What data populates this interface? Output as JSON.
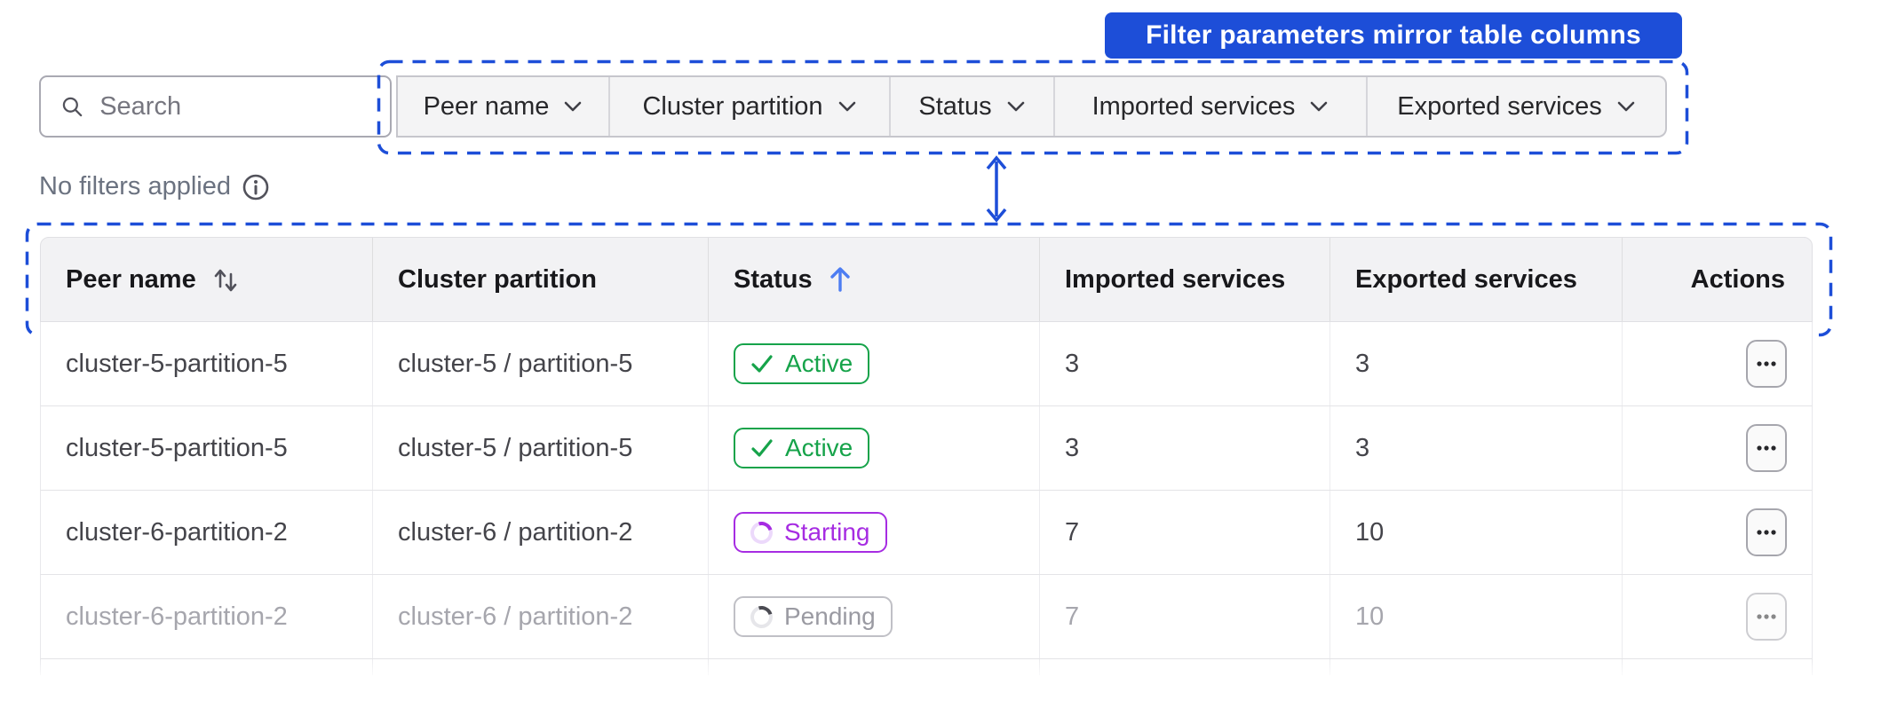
{
  "annotation": {
    "banner_text": "Filter parameters mirror table columns"
  },
  "search": {
    "placeholder": "Search"
  },
  "filters": [
    {
      "label": "Peer name"
    },
    {
      "label": "Cluster partition"
    },
    {
      "label": "Status"
    },
    {
      "label": "Imported services"
    },
    {
      "label": "Exported services"
    }
  ],
  "filter_status_text": "No filters applied",
  "table": {
    "columns": [
      {
        "label": "Peer name",
        "sort": "both"
      },
      {
        "label": "Cluster partition",
        "sort": "none"
      },
      {
        "label": "Status",
        "sort": "asc"
      },
      {
        "label": "Imported services",
        "sort": "none"
      },
      {
        "label": "Exported services",
        "sort": "none"
      },
      {
        "label": "Actions",
        "sort": "none"
      }
    ],
    "rows": [
      {
        "peer_name": "cluster-5-partition-5",
        "cluster_partition": "cluster-5 / partition-5",
        "status": "Active",
        "status_kind": "active",
        "imported": "3",
        "exported": "3",
        "dimmed": false
      },
      {
        "peer_name": "cluster-5-partition-5",
        "cluster_partition": "cluster-5 / partition-5",
        "status": "Active",
        "status_kind": "active",
        "imported": "3",
        "exported": "3",
        "dimmed": false
      },
      {
        "peer_name": "cluster-6-partition-2",
        "cluster_partition": "cluster-6 / partition-2",
        "status": "Starting",
        "status_kind": "starting",
        "imported": "7",
        "exported": "10",
        "dimmed": false
      },
      {
        "peer_name": "cluster-6-partition-2",
        "cluster_partition": "cluster-6 / partition-2",
        "status": "Pending",
        "status_kind": "pending",
        "imported": "7",
        "exported": "10",
        "dimmed": true
      }
    ]
  },
  "colors": {
    "annotation_blue": "#1d4ed8",
    "sort_arrow_blue": "#4d7df2",
    "status_active_green": "#16a34a",
    "status_starting_purple": "#a62ce2",
    "status_pending_gray": "#6f6f78",
    "header_bg": "#f2f2f4",
    "filter_bg": "#f4f4f5"
  }
}
